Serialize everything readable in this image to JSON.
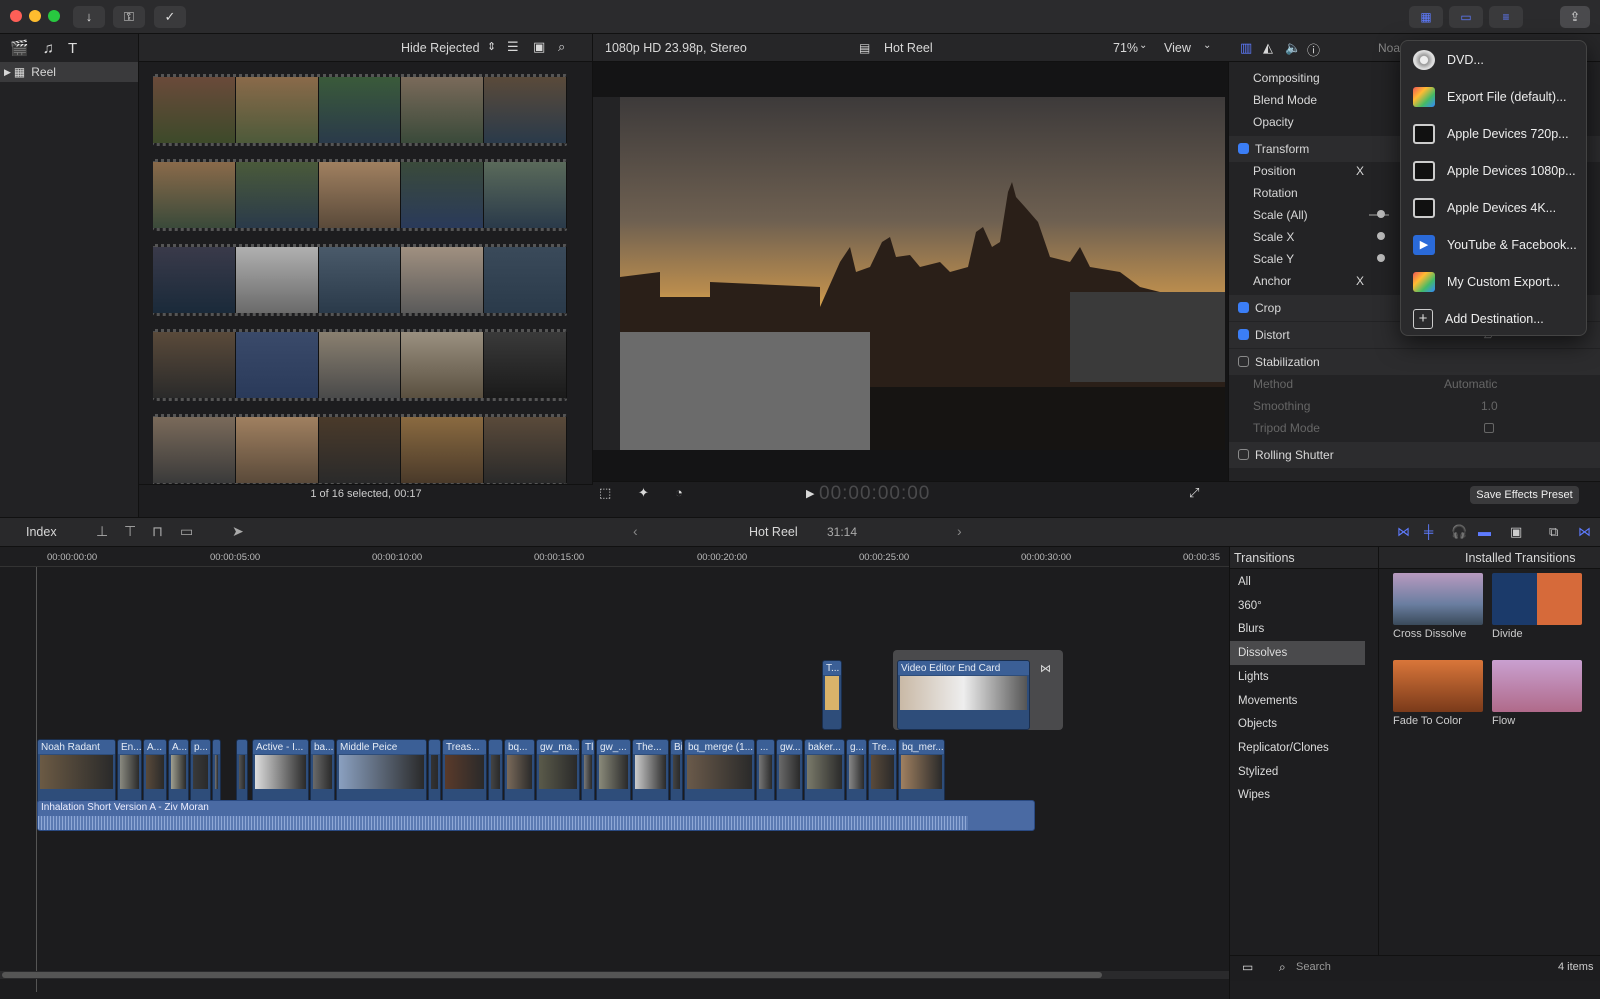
{
  "browser": {
    "filter_label": "Hide Rejected",
    "selection_status": "1 of 16 selected, 00:17"
  },
  "library": {
    "item_label": "Reel"
  },
  "viewer": {
    "format": "1080p HD 23.98p, Stereo",
    "project_name": "Hot Reel",
    "zoom": "71%",
    "view_label": "View",
    "timecode": "00:00:00:00"
  },
  "inspector": {
    "owner_partial": "Noa",
    "rows": {
      "compositing": "Compositing",
      "blend_mode": "Blend Mode",
      "opacity": "Opacity",
      "transform": "Transform",
      "position": "Position",
      "position_axis": "X",
      "rotation": "Rotation",
      "scale_all": "Scale (All)",
      "scale_x": "Scale X",
      "scale_y": "Scale Y",
      "anchor": "Anchor",
      "anchor_axis": "X",
      "crop": "Crop",
      "distort": "Distort",
      "stabilization": "Stabilization",
      "method": "Method",
      "method_value": "Automatic",
      "smoothing": "Smoothing",
      "smoothing_value": "1.0",
      "tripod_mode": "Tripod Mode",
      "rolling_shutter": "Rolling Shutter"
    },
    "save_preset": "Save Effects Preset"
  },
  "share_menu": {
    "items": [
      {
        "label": "DVD...",
        "icon": "dvd-icon"
      },
      {
        "label": "Export File (default)...",
        "icon": "export-file-icon"
      },
      {
        "label": "Apple Devices 720p...",
        "icon": "apple-devices-icon"
      },
      {
        "label": "Apple Devices 1080p...",
        "icon": "apple-devices-icon"
      },
      {
        "label": "Apple Devices 4K...",
        "icon": "apple-devices-icon"
      },
      {
        "label": "YouTube & Facebook...",
        "icon": "youtube-icon"
      },
      {
        "label": "My Custom Export...",
        "icon": "custom-export-icon"
      },
      {
        "label": "Add Destination...",
        "icon": "add-icon"
      }
    ]
  },
  "timeline": {
    "index_label": "Index",
    "project_name": "Hot Reel",
    "duration": "31:14",
    "ruler_labels": [
      "00:00:00:00",
      "00:00:05:00",
      "00:00:10:00",
      "00:00:15:00",
      "00:00:20:00",
      "00:00:25:00",
      "00:00:30:00",
      "00:00:35"
    ],
    "title_clip": "Video Editor End Card",
    "title_clip_small": "T...",
    "clips": [
      "Noah Radant",
      "En...",
      "A...",
      "A...",
      "p...",
      "",
      "",
      "Active - I...",
      "ba...",
      "Middle Peice",
      "",
      "Treas...",
      "",
      "bq...",
      "gw_ma...",
      "Tl",
      "gw_...",
      "The...",
      "Bi",
      "bq_merge (1...",
      "...",
      "gw...",
      "baker...",
      "g...",
      "Tre...",
      "bq_mer..."
    ],
    "audio_clip": "Inhalation   Short Version A - Ziv Moran"
  },
  "transitions": {
    "title": "Transitions",
    "installed": "Installed Transitions",
    "categories": [
      "All",
      "360°",
      "Blurs",
      "Dissolves",
      "Lights",
      "Movements",
      "Objects",
      "Replicator/Clones",
      "Stylized",
      "Wipes"
    ],
    "selected_category": "Dissolves",
    "items": [
      "Cross Dissolve",
      "Divide",
      "Fade To Color",
      "Flow"
    ],
    "search_placeholder": "Search",
    "count": "4 items"
  },
  "colors": {
    "accent": "#5e7bff",
    "clip_blue": "#2e4d7a",
    "audio_blue": "#4a6aa3"
  }
}
